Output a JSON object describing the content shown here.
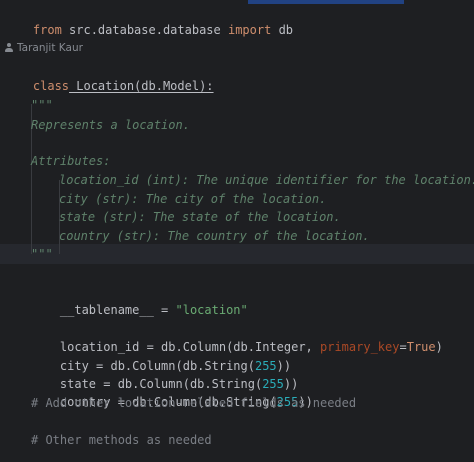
{
  "editor": {
    "author": "Taranjit Kaur",
    "lines": {
      "l1": {
        "kw_from": "from",
        "module": " src.database.database ",
        "kw_import": "import",
        "name": " db"
      },
      "l2": {
        "kw_class": "class",
        "decl": " Location(db.Model):"
      },
      "l3": {
        "text": "\"\"\""
      },
      "l4": {
        "text": "Represents a location."
      },
      "l5": {
        "text": "Attributes:"
      },
      "l6": {
        "text": "location_id (int): The unique identifier for the location."
      },
      "l7": {
        "text": "city (str): The city of the location."
      },
      "l8": {
        "text": "state (str): The state of the location."
      },
      "l9": {
        "text": "country (str): The country of the location."
      },
      "l10": {
        "text": "\"\"\""
      },
      "l11": {
        "name": "__tablename__ = ",
        "value": "\"location\""
      },
      "l12": {
        "pre": "location_id = db.Column(db.Integer, ",
        "param": "primary_key",
        "eq": "=",
        "kw_true": "True",
        "post": ")"
      },
      "l13": {
        "pre": "city = db.Column(db.String(",
        "num": "255",
        "post": "))"
      },
      "l14": {
        "pre": "state = db.Column(db.String(",
        "num": "255",
        "post": "))"
      },
      "l15": {
        "pre": "country = db.Column(db.String(",
        "num": "255",
        "post": "))"
      },
      "l16": {
        "text": "# Add other location-related fields as needed"
      },
      "l17": {
        "text": "# Other methods as needed"
      }
    }
  },
  "colors": {
    "background": "#1e1f22",
    "keyword": "#cf8e6d",
    "docstring": "#5f826b",
    "string": "#6aab73",
    "number": "#2aacb8",
    "parameter": "#aa4926",
    "comment": "#7a7e85"
  }
}
